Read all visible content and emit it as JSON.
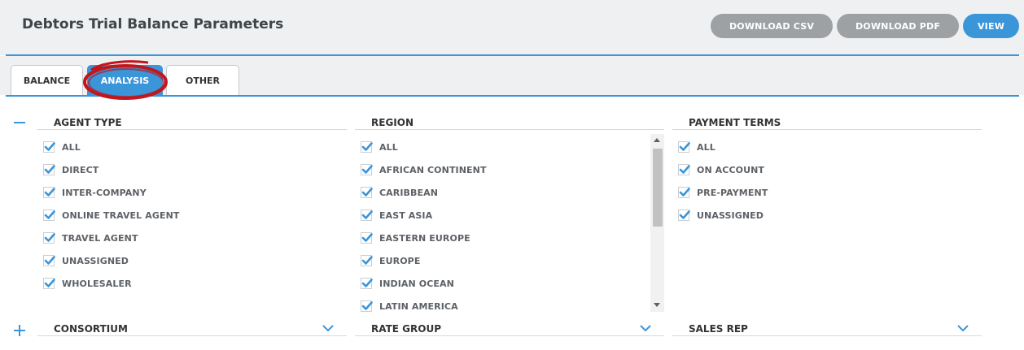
{
  "header": {
    "title": "Debtors Trial Balance Parameters",
    "buttons": {
      "csv": "DOWNLOAD CSV",
      "pdf": "DOWNLOAD PDF",
      "view": "VIEW"
    }
  },
  "tabs": [
    {
      "label": "BALANCE"
    },
    {
      "label": "ANALYSIS",
      "active": true
    },
    {
      "label": "OTHER"
    }
  ],
  "sections": {
    "agent_type": {
      "title": "AGENT TYPE",
      "options": [
        "ALL",
        "DIRECT",
        "INTER-COMPANY",
        "ONLINE TRAVEL AGENT",
        "TRAVEL AGENT",
        "UNASSIGNED",
        "WHOLESALER"
      ]
    },
    "region": {
      "title": "REGION",
      "options": [
        "ALL",
        "AFRICAN CONTINENT",
        "CARIBBEAN",
        "EAST ASIA",
        "EASTERN EUROPE",
        "EUROPE",
        "INDIAN OCEAN",
        "LATIN AMERICA"
      ]
    },
    "payment_terms": {
      "title": "PAYMENT TERMS",
      "options": [
        "ALL",
        "ON ACCOUNT",
        "PRE-PAYMENT",
        "UNASSIGNED"
      ]
    },
    "consortium": {
      "title": "CONSORTIUM"
    },
    "rate_group": {
      "title": "RATE GROUP"
    },
    "sales_rep": {
      "title": "SALES REP"
    }
  },
  "colors": {
    "accent": "#3b95d9",
    "button_grey": "#9ea1a4",
    "annotation": "#c0161c"
  },
  "icons": {
    "collapse": "minus-icon",
    "expand": "plus-icon",
    "dropdown": "chevron-down-icon",
    "check": "check-icon"
  }
}
